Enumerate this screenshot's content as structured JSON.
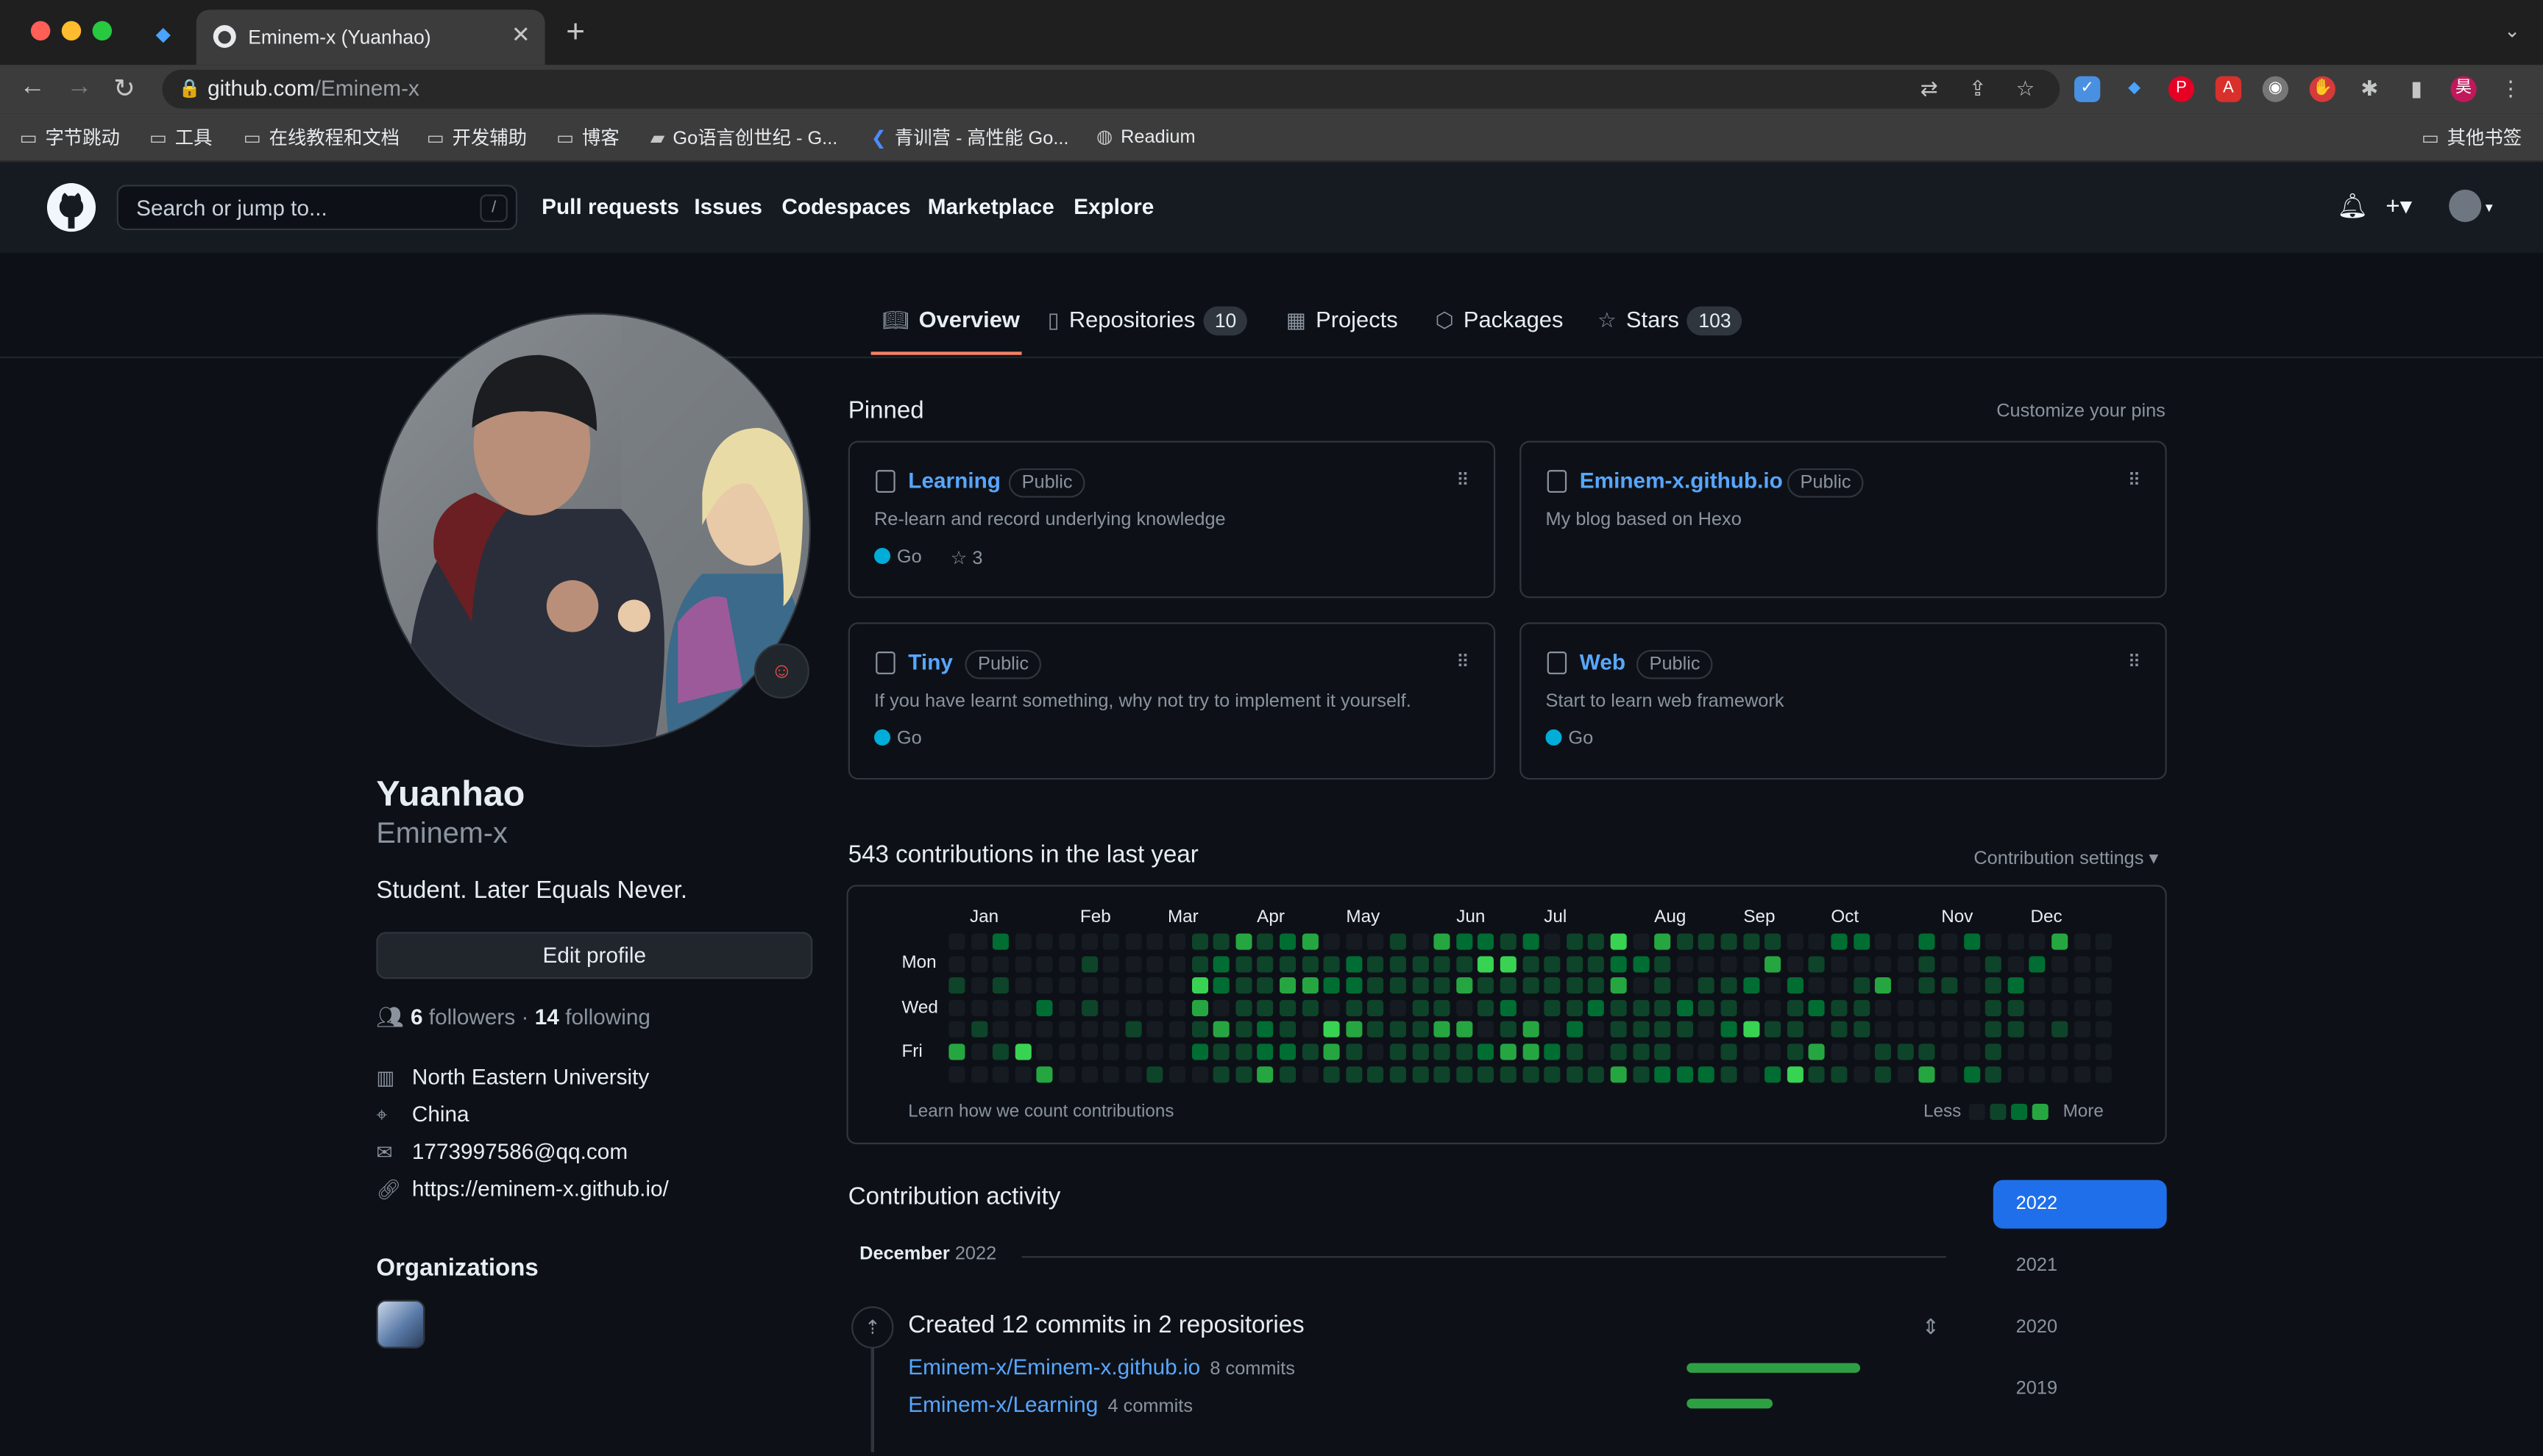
{
  "browser": {
    "tab_title": "Eminem-x (Yuanhao)",
    "url_host": "github.com",
    "url_path": "/Eminem-x",
    "bookmarks": [
      "字节跳动",
      "工具",
      "在线教程和文档",
      "开发辅助",
      "博客",
      "Go语言创世纪 - G...",
      "青训营 - 高性能 Go...",
      "Readium"
    ],
    "other_bookmarks": "其他书签"
  },
  "gh_header": {
    "search_placeholder": "Search or jump to...",
    "search_shortcut": "/",
    "nav": [
      "Pull requests",
      "Issues",
      "Codespaces",
      "Marketplace",
      "Explore"
    ]
  },
  "profile_tabs": {
    "overview": "Overview",
    "repositories": "Repositories",
    "repositories_count": "10",
    "projects": "Projects",
    "packages": "Packages",
    "stars": "Stars",
    "stars_count": "103"
  },
  "profile": {
    "name": "Yuanhao",
    "login": "Eminem-x",
    "bio": "Student. Later Equals Never.",
    "edit_button": "Edit profile",
    "followers": "6",
    "followers_label": "followers",
    "separator": "·",
    "following": "14",
    "following_label": "following",
    "organization": "North Eastern University",
    "location": "China",
    "email": "1773997586@qq.com",
    "website": "https://eminem-x.github.io/",
    "organizations_title": "Organizations"
  },
  "pinned": {
    "title": "Pinned",
    "customize": "Customize your pins",
    "items": [
      {
        "name": "Learning",
        "badge": "Public",
        "desc": "Re-learn and record underlying knowledge",
        "lang": "Go",
        "stars": "3"
      },
      {
        "name": "Eminem-x.github.io",
        "badge": "Public",
        "desc": "My blog based on Hexo",
        "lang": "",
        "stars": ""
      },
      {
        "name": "Tiny",
        "badge": "Public",
        "desc": "If you have learnt something, why not try to implement it yourself.",
        "lang": "Go",
        "stars": ""
      },
      {
        "name": "Web",
        "badge": "Public",
        "desc": "Start to learn web framework",
        "lang": "Go",
        "stars": ""
      }
    ]
  },
  "contributions": {
    "title": "543 contributions in the last year",
    "settings": "Contribution settings ▾",
    "months": [
      "Jan",
      "Feb",
      "Mar",
      "Apr",
      "May",
      "Jun",
      "Jul",
      "Aug",
      "Sep",
      "Oct",
      "Nov",
      "Dec"
    ],
    "days": [
      "Mon",
      "Wed",
      "Fri"
    ],
    "learn_link": "Learn how we count contributions",
    "less": "Less",
    "more": "More",
    "colors": [
      "#161b22",
      "#0e4429",
      "#006d32",
      "#26a641",
      "#39d353"
    ]
  },
  "activity": {
    "title": "Contribution activity",
    "years": [
      "2022",
      "2021",
      "2020",
      "2019"
    ],
    "month_header": "December",
    "month_year": "2022",
    "headline": "Created 12 commits in 2 repositories",
    "repos": [
      {
        "name": "Eminem-x/Eminem-x.github.io",
        "commits": "8 commits",
        "share": 0.67
      },
      {
        "name": "Eminem-x/Learning",
        "commits": "4 commits",
        "share": 0.33
      }
    ]
  }
}
